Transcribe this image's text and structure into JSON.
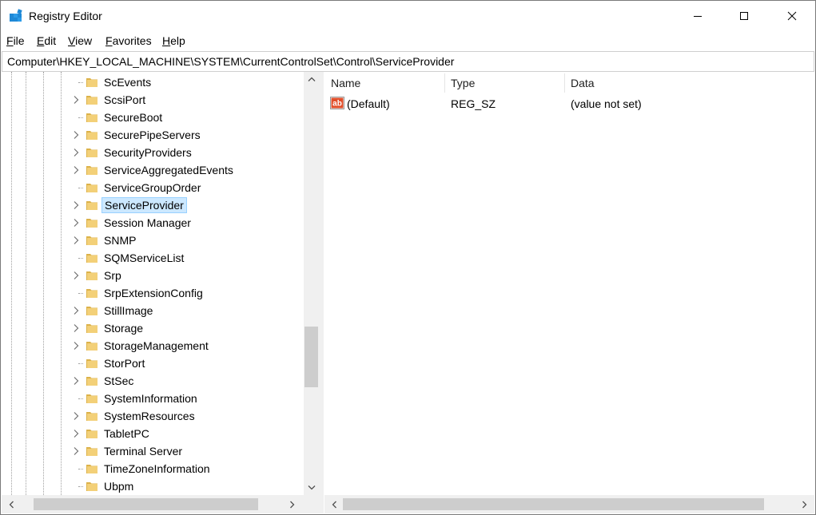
{
  "window": {
    "title": "Registry Editor"
  },
  "menu": [
    {
      "key": "F",
      "rest": "ile"
    },
    {
      "key": "E",
      "rest": "dit"
    },
    {
      "key": "V",
      "rest": "iew"
    },
    {
      "key": "F",
      "rest": "avorites"
    },
    {
      "key": "H",
      "rest": "elp"
    }
  ],
  "address": {
    "path": "Computer\\HKEY_LOCAL_MACHINE\\SYSTEM\\CurrentControlSet\\Control\\ServiceProvider"
  },
  "tree": {
    "items": [
      {
        "label": "ScEvents",
        "expandable": false,
        "selected": false
      },
      {
        "label": "ScsiPort",
        "expandable": true,
        "selected": false
      },
      {
        "label": "SecureBoot",
        "expandable": false,
        "selected": false
      },
      {
        "label": "SecurePipeServers",
        "expandable": true,
        "selected": false
      },
      {
        "label": "SecurityProviders",
        "expandable": true,
        "selected": false
      },
      {
        "label": "ServiceAggregatedEvents",
        "expandable": true,
        "selected": false
      },
      {
        "label": "ServiceGroupOrder",
        "expandable": false,
        "selected": false
      },
      {
        "label": "ServiceProvider",
        "expandable": true,
        "selected": true
      },
      {
        "label": "Session Manager",
        "expandable": true,
        "selected": false
      },
      {
        "label": "SNMP",
        "expandable": true,
        "selected": false
      },
      {
        "label": "SQMServiceList",
        "expandable": false,
        "selected": false
      },
      {
        "label": "Srp",
        "expandable": true,
        "selected": false
      },
      {
        "label": "SrpExtensionConfig",
        "expandable": false,
        "selected": false
      },
      {
        "label": "StillImage",
        "expandable": true,
        "selected": false
      },
      {
        "label": "Storage",
        "expandable": true,
        "selected": false
      },
      {
        "label": "StorageManagement",
        "expandable": true,
        "selected": false
      },
      {
        "label": "StorPort",
        "expandable": false,
        "selected": false
      },
      {
        "label": "StSec",
        "expandable": true,
        "selected": false
      },
      {
        "label": "SystemInformation",
        "expandable": false,
        "selected": false
      },
      {
        "label": "SystemResources",
        "expandable": true,
        "selected": false
      },
      {
        "label": "TabletPC",
        "expandable": true,
        "selected": false
      },
      {
        "label": "Terminal Server",
        "expandable": true,
        "selected": false
      },
      {
        "label": "TimeZoneInformation",
        "expandable": false,
        "selected": false
      },
      {
        "label": "Ubpm",
        "expandable": false,
        "selected": false
      }
    ]
  },
  "list": {
    "columns": [
      "Name",
      "Type",
      "Data"
    ],
    "rows": [
      {
        "name": "(Default)",
        "type": "REG_SZ",
        "data": "(value not set)",
        "icon": "string-value-icon"
      }
    ]
  },
  "colors": {
    "selection_bg": "#cce8ff",
    "selection_border": "#99d1ff",
    "folder": "#e8c25a",
    "scrollbar": "#f0f0f0"
  }
}
